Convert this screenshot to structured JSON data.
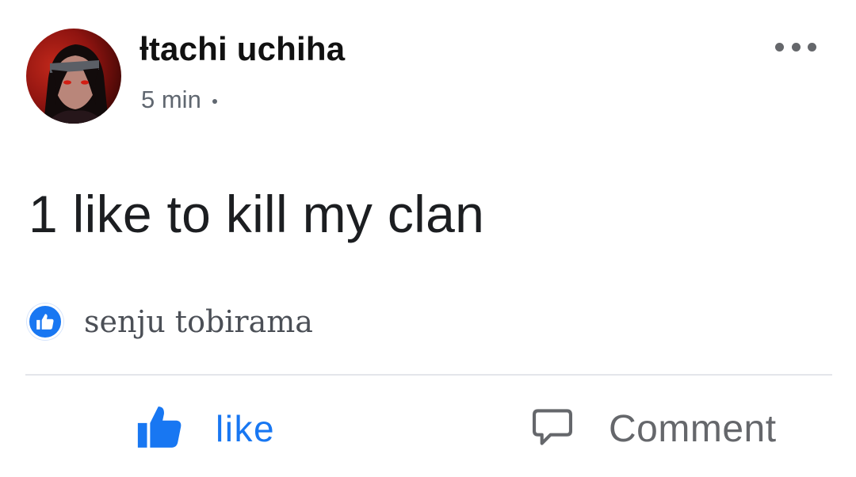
{
  "post": {
    "author": {
      "name": "ƚtachi uchiha",
      "avatar_icon": "profile-avatar"
    },
    "meta": {
      "time": "5 min",
      "separator_icon": "dot-icon"
    },
    "more_icon": "more-options-icon",
    "text": "1 like to kill my clan",
    "reactions": {
      "icon": "like-reaction-icon",
      "reactors": "senju tobirama"
    },
    "actions": {
      "like": {
        "label": "like",
        "icon": "thumbs-up-icon"
      },
      "comment": {
        "label": "Comment",
        "icon": "comment-icon"
      }
    }
  },
  "colors": {
    "accent": "#1877f2",
    "text": "#1c1e21",
    "secondary": "#65676b",
    "divider": "#e4e6eb"
  }
}
